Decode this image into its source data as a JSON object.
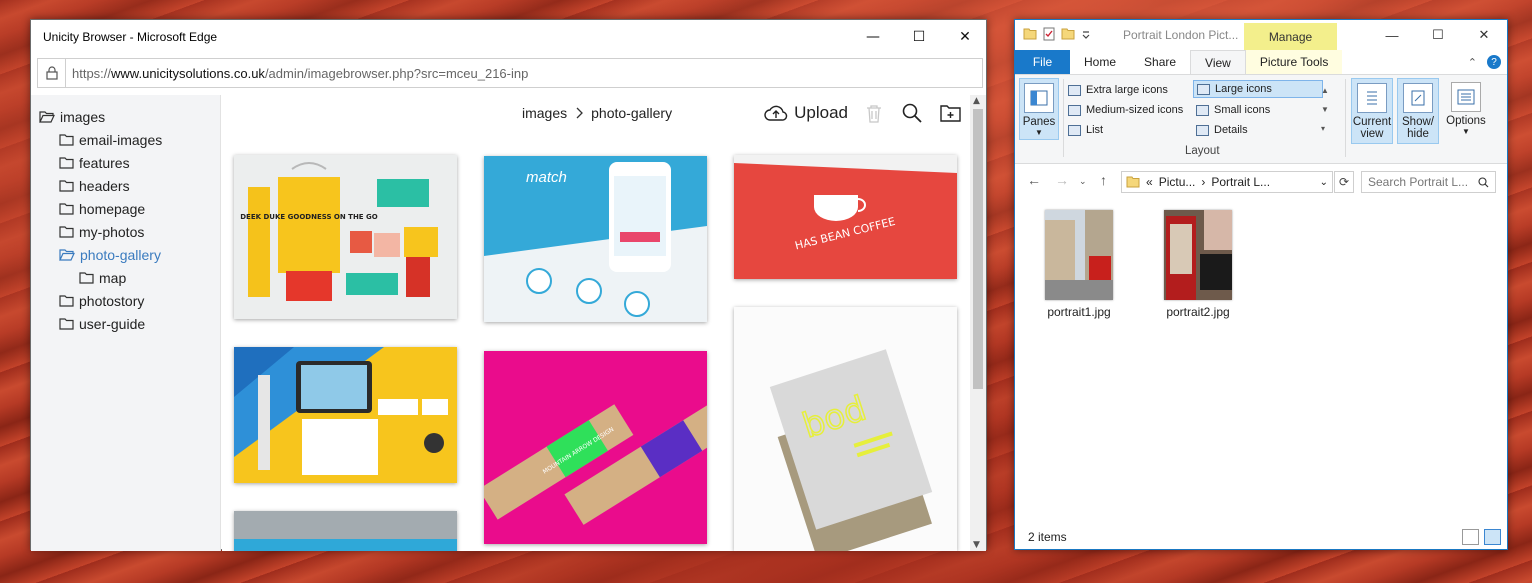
{
  "edge": {
    "title": "Unicity Browser - Microsoft Edge",
    "url_prefix": "https://",
    "url_domain": "www.unicitysolutions.co.uk",
    "url_path": "/admin/imagebrowser.php?src=mceu_216-inp",
    "win_min": "—",
    "win_max": "☐",
    "win_close": "✕"
  },
  "image_browser": {
    "folders": [
      {
        "label": "images",
        "level": 0,
        "open": true
      },
      {
        "label": "email-images",
        "level": 1
      },
      {
        "label": "features",
        "level": 1
      },
      {
        "label": "headers",
        "level": 1
      },
      {
        "label": "homepage",
        "level": 1
      },
      {
        "label": "my-photos",
        "level": 1
      },
      {
        "label": "photo-gallery",
        "level": 1,
        "active": true,
        "open": true
      },
      {
        "label": "map",
        "level": 2
      },
      {
        "label": "photostory",
        "level": 1
      },
      {
        "label": "user-guide",
        "level": 1
      }
    ],
    "breadcrumb": {
      "root": "images",
      "current": "photo-gallery"
    },
    "upload_label": "Upload",
    "thumb_texts": {
      "deek_duke": "DEEK DUKE GOODNESS ON THE GO",
      "match": "match",
      "has_bean": "HAS BEAN COFFEE",
      "mountain": "MOUNTAIN ARROW DESIGN",
      "bod": "bod"
    }
  },
  "explorer": {
    "title": "Portrait London Pict...",
    "manage_tab": "Manage",
    "tabs": [
      "File",
      "Home",
      "Share",
      "View",
      "Picture Tools"
    ],
    "win_min": "—",
    "win_max": "☐",
    "win_close": "✕",
    "ribbon": {
      "panes": "Panes",
      "layout_items": [
        "Extra large icons",
        "Large icons",
        "Medium-sized icons",
        "Small icons",
        "List",
        "Details"
      ],
      "layout_label": "Layout",
      "current_view": "Current view",
      "show_hide": "Show/ hide",
      "options": "Options"
    },
    "address": {
      "part1": "Pictu...",
      "part2": "Portrait L...",
      "prefix": "«"
    },
    "search_placeholder": "Search Portrait L...",
    "files": [
      "portrait1.jpg",
      "portrait2.jpg"
    ],
    "status": "2 items"
  }
}
